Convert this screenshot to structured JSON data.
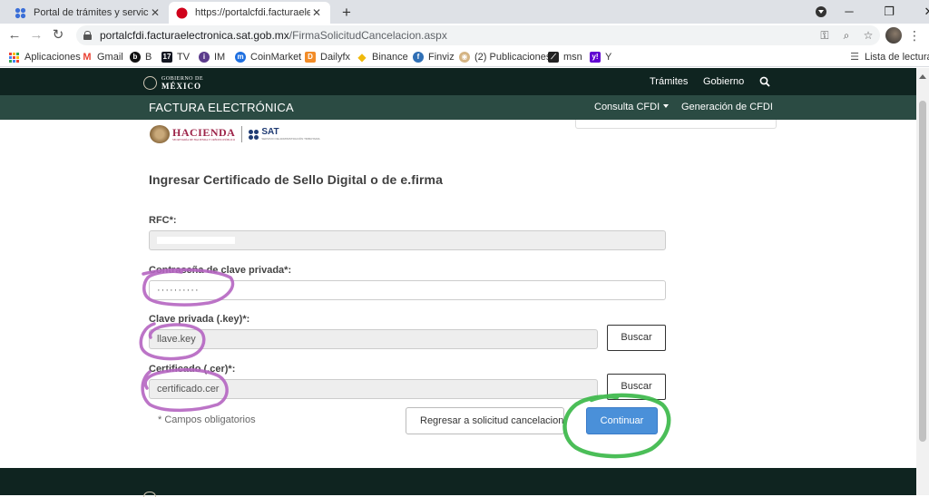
{
  "browser": {
    "tabs": [
      {
        "title": "Portal de trámites y servicios - SA",
        "active": false
      },
      {
        "title": "https://portalcfdi.facturaelectronic",
        "active": true
      }
    ],
    "new_tab_symbol": "+",
    "url_host": "portalcfdi.facturaelectronica.sat.gob.mx",
    "url_path": "/FirmaSolicitudCancelacion.aspx",
    "bookmarks": [
      {
        "label": "Aplicaciones",
        "icon": "apps-grid-icon"
      },
      {
        "label": "Gmail",
        "icon": "gmail-icon"
      },
      {
        "label": "B",
        "icon": "bitso-icon"
      },
      {
        "label": "TV",
        "icon": "tradingview-icon"
      },
      {
        "label": "IM",
        "icon": "investing-icon"
      },
      {
        "label": "CoinMarket",
        "icon": "coinmarketcap-icon"
      },
      {
        "label": "Dailyfx",
        "icon": "dailyfx-icon"
      },
      {
        "label": "Binance",
        "icon": "binance-icon"
      },
      {
        "label": "Finviz",
        "icon": "finviz-icon"
      },
      {
        "label": "(2) Publicaciones",
        "icon": "publicaciones-icon"
      },
      {
        "label": "msn",
        "icon": "msn-icon"
      },
      {
        "label": "Y",
        "icon": "yahoo-icon"
      }
    ],
    "reading_list": "Lista de lectura"
  },
  "gov_header": {
    "logo_line1": "GOBIERNO DE",
    "logo_line2": "MÉXICO",
    "nav_tramites": "Trámites",
    "nav_gobierno": "Gobierno"
  },
  "fe_header": {
    "title": "FACTURA ELECTRÓNICA",
    "nav_consulta": "Consulta CFDI",
    "nav_generacion": "Generación de CFDI"
  },
  "logos": {
    "hacienda": "HACIENDA",
    "hacienda_sub": "SECRETARÍA DE HACIENDA Y CRÉDITO PÚBLICO",
    "sat": "SAT",
    "sat_sub": "SERVICIO DE ADMINISTRACIÓN TRIBUTARIA"
  },
  "form": {
    "title": "Ingresar Certificado de Sello Digital o de e.firma",
    "rfc_label": "RFC*:",
    "password_label": "Contraseña de clave privada*:",
    "password_value": "··········",
    "key_label": "Clave privada (.key)*:",
    "key_value": "llave.key",
    "cer_label": "Certificado (.cer)*:",
    "cer_value": "certificado.cer",
    "search_label": "Buscar",
    "required_note": "* Campos obligatorios",
    "back_label": "Regresar a solicitud cancelacion",
    "continue_label": "Continuar"
  },
  "colors": {
    "gov_dark": "#0f2420",
    "fe_green": "#2b4b43",
    "primary_button": "#4a90d9",
    "annotation_purple": "#b565c2",
    "annotation_green": "#3cb84a"
  }
}
